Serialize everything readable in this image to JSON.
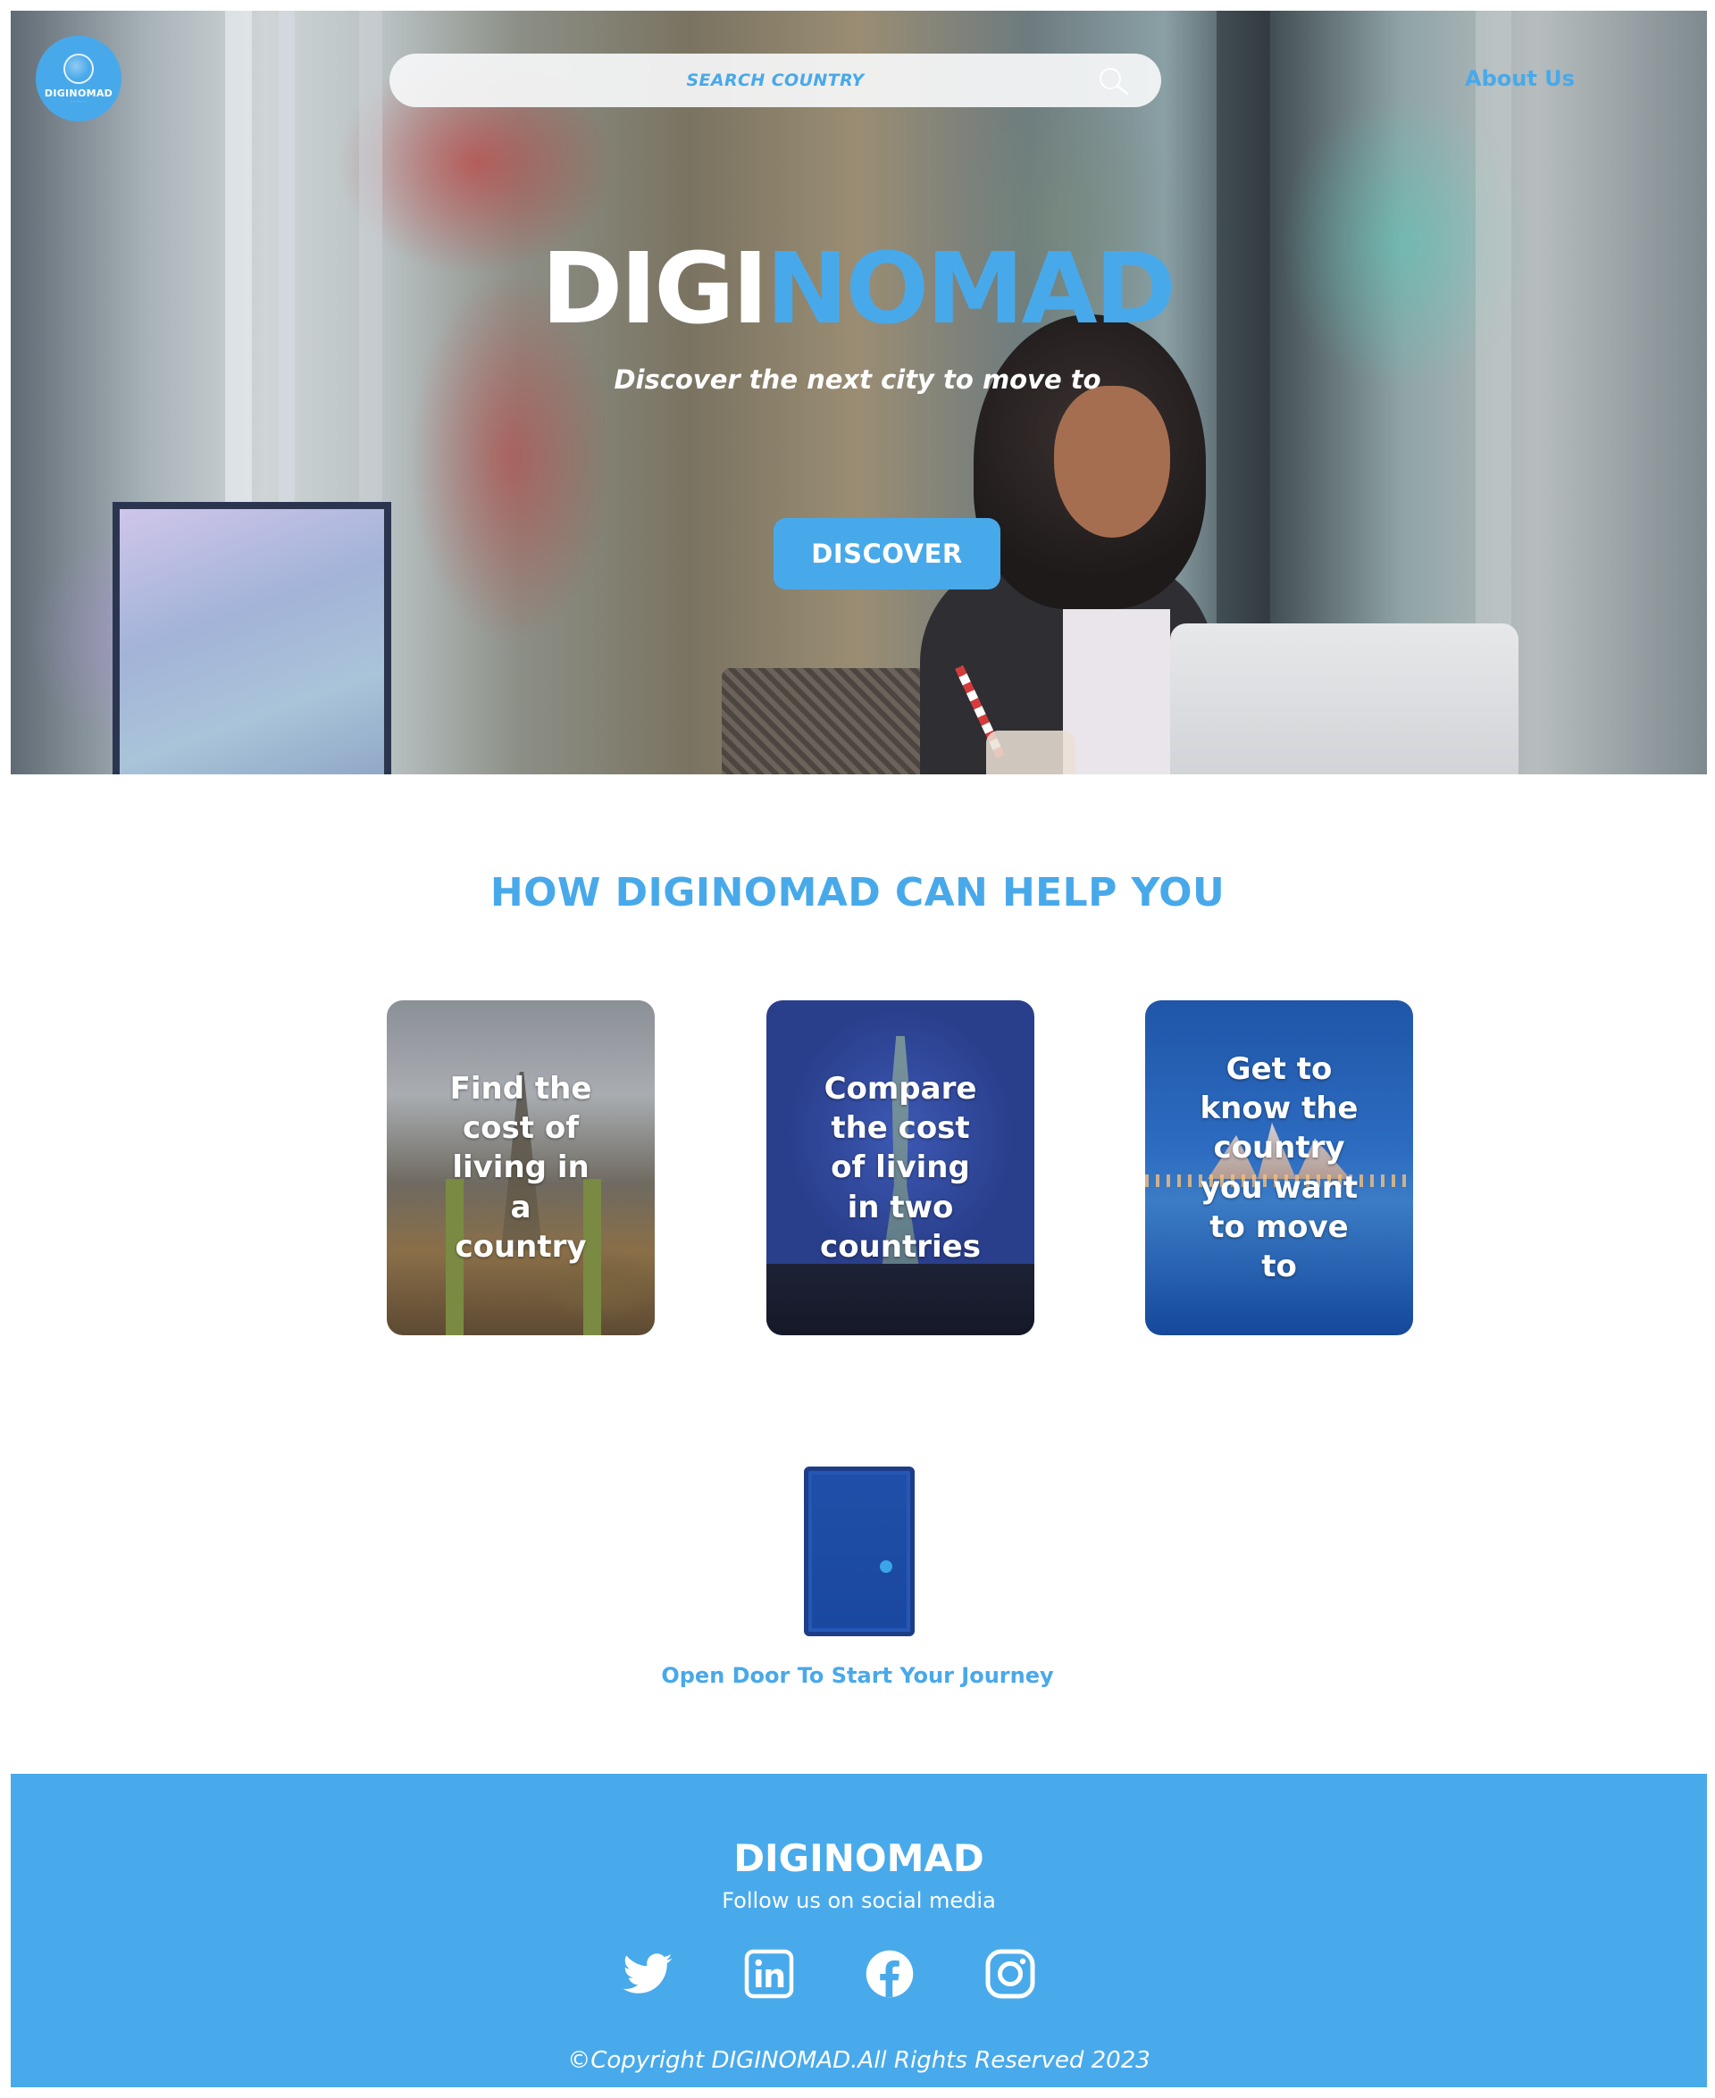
{
  "header": {
    "logo_text": "DIGINOMAD",
    "search": {
      "placeholder": "SEARCH COUNTRY"
    },
    "about_link": "About Us"
  },
  "hero": {
    "title_white": "DIGI",
    "title_blue": "NOMAD",
    "subtitle": "Discover the next city to move to",
    "cta_label": "DISCOVER"
  },
  "help": {
    "title": "HOW DIGINOMAD CAN HELP YOU",
    "cards": [
      {
        "label": "Find the cost of living in a country"
      },
      {
        "label": "Compare the cost of living in two countries"
      },
      {
        "label": "Get to know the country you want to move to"
      }
    ]
  },
  "door": {
    "label": "Open Door To Start Your Journey"
  },
  "footer": {
    "title": "DIGINOMAD",
    "subtitle": "Follow us on social media",
    "social": [
      "twitter-icon",
      "linkedin-icon",
      "facebook-icon",
      "instagram-icon"
    ],
    "copyright": "©Copyright DIGINOMAD.All Rights Reserved 2023"
  },
  "colors": {
    "accent": "#48a9ea",
    "footer_bg": "#48aaeb",
    "door": "#1f4fa8",
    "text_on_accent": "#ffffff"
  }
}
